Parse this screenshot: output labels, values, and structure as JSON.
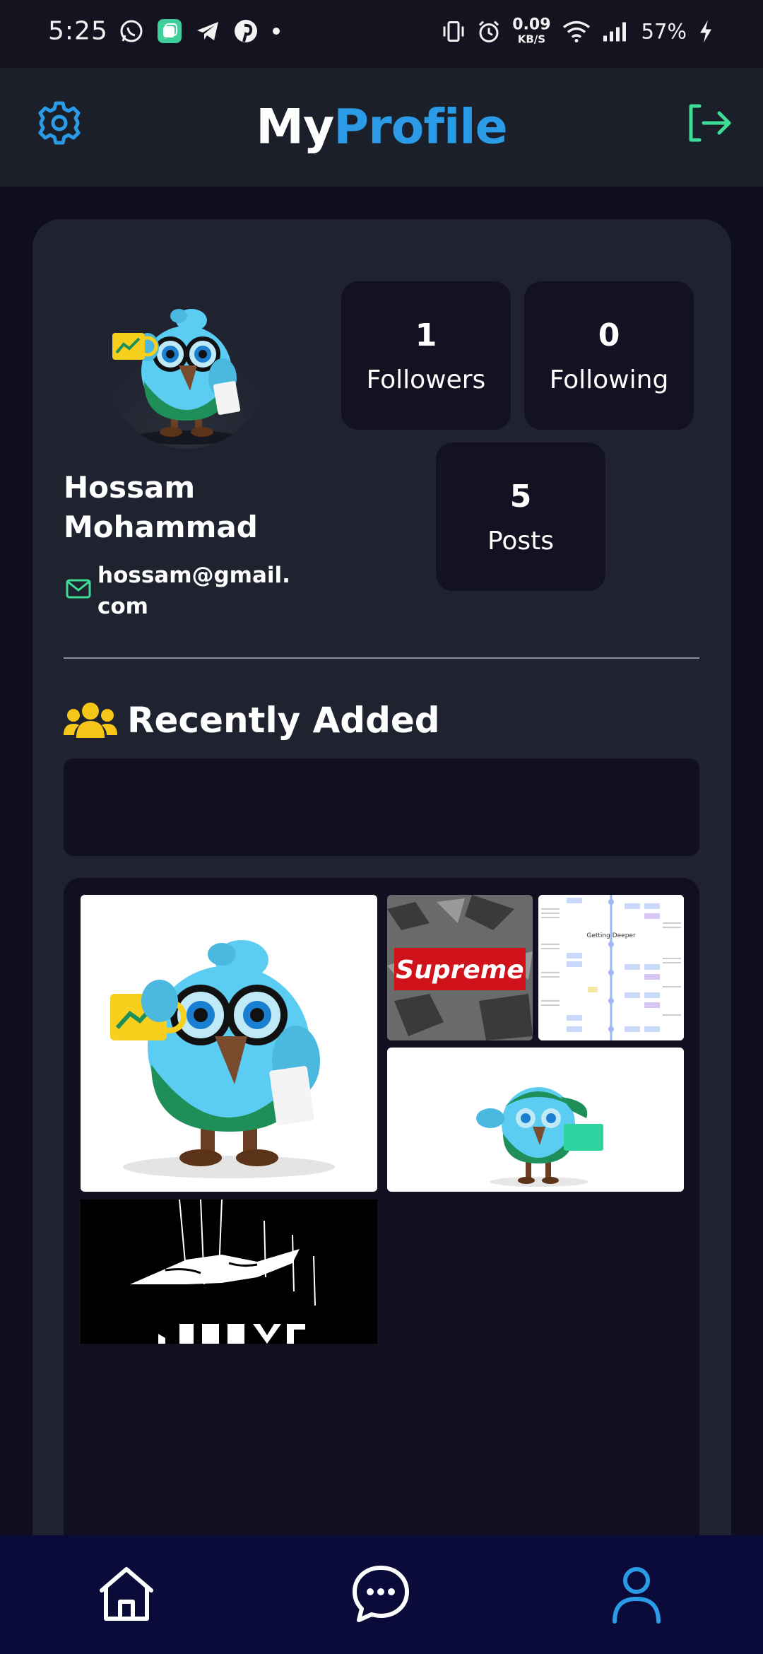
{
  "status_bar": {
    "time": "5:25",
    "net_speed_value": "0.09",
    "net_speed_unit": "KB/S",
    "battery": "57%",
    "left_icons": [
      "whatsapp-icon",
      "app-icon",
      "telegram-icon",
      "pinterest-icon",
      "dot-icon"
    ],
    "right_icons": [
      "vibrate-icon",
      "alarm-icon",
      "wifi-icon",
      "signal-icon",
      "charging-icon"
    ]
  },
  "header": {
    "title_part1": "My",
    "title_part2": "Profile",
    "settings_icon": "gear-icon",
    "logout_icon": "logout-icon",
    "accent_color": "#2b9be8",
    "logout_color": "#3ddc97"
  },
  "profile": {
    "name": "Hossam Mohammad",
    "email": "hossam@gmail.com",
    "stats": {
      "followers_count": "1",
      "followers_label": "Followers",
      "following_count": "0",
      "following_label": "Following",
      "posts_count": "5",
      "posts_label": "Posts"
    }
  },
  "recent": {
    "title": "Recently Added",
    "icon": "users-icon",
    "icon_color": "#f5c518",
    "images": [
      {
        "alt": "bird mascot holding mug"
      },
      {
        "alt": "supreme logo on cracked wall",
        "text": "Supreme"
      },
      {
        "alt": "flowchart document",
        "text": "Getting Deeper"
      },
      {
        "alt": "bird mascot with laptop"
      },
      {
        "alt": "black and white diving figure"
      }
    ]
  },
  "bottom_nav": {
    "items": [
      {
        "name": "home",
        "icon": "home-icon",
        "active": false
      },
      {
        "name": "chat",
        "icon": "chat-icon",
        "active": false
      },
      {
        "name": "profile",
        "icon": "user-icon",
        "active": true
      }
    ],
    "active_color": "#2b9be8"
  }
}
